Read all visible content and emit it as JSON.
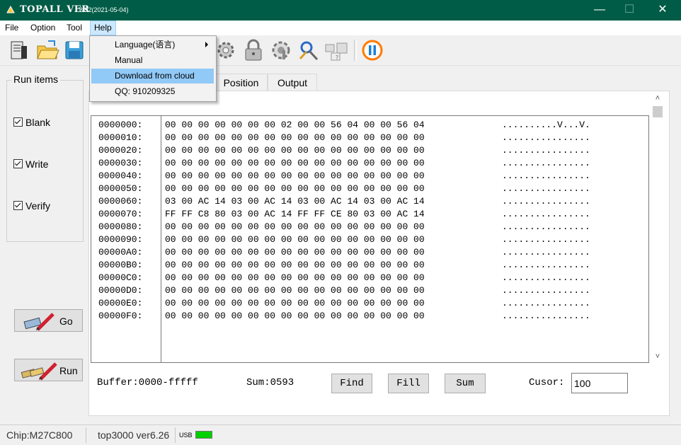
{
  "window": {
    "title": "TOPALL VER",
    "version": "8.92(2021-05-04)",
    "minimize": "—",
    "maximize": "☐",
    "close": "✕"
  },
  "menu": {
    "file": "File",
    "option": "Option",
    "tool": "Tool",
    "help": "Help"
  },
  "help_menu": {
    "language": "Language(语言)",
    "manual": "Manual",
    "download": "Download from  cloud",
    "qq": "QQ: 910209325"
  },
  "run_items": {
    "title": "Run items",
    "blank": "Blank",
    "write": "Write",
    "verify": "Verify",
    "go": "Go",
    "run": "Run"
  },
  "tabs": {
    "position": "Position",
    "output": "Output"
  },
  "hex": {
    "rows": [
      {
        "addr": "0000000:",
        "bytes": "00 00 00 00 00 00 00 02 00 00 56 04 00 00 56 04",
        "ascii": "..........V...V."
      },
      {
        "addr": "0000010:",
        "bytes": "00 00 00 00 00 00 00 00 00 00 00 00 00 00 00 00",
        "ascii": "................"
      },
      {
        "addr": "0000020:",
        "bytes": "00 00 00 00 00 00 00 00 00 00 00 00 00 00 00 00",
        "ascii": "................"
      },
      {
        "addr": "0000030:",
        "bytes": "00 00 00 00 00 00 00 00 00 00 00 00 00 00 00 00",
        "ascii": "................"
      },
      {
        "addr": "0000040:",
        "bytes": "00 00 00 00 00 00 00 00 00 00 00 00 00 00 00 00",
        "ascii": "................"
      },
      {
        "addr": "0000050:",
        "bytes": "00 00 00 00 00 00 00 00 00 00 00 00 00 00 00 00",
        "ascii": "................"
      },
      {
        "addr": "0000060:",
        "bytes": "03 00 AC 14 03 00 AC 14 03 00 AC 14 03 00 AC 14",
        "ascii": "................"
      },
      {
        "addr": "0000070:",
        "bytes": "FF FF C8 80 03 00 AC 14 FF FF CE 80 03 00 AC 14",
        "ascii": "................"
      },
      {
        "addr": "0000080:",
        "bytes": "00 00 00 00 00 00 00 00 00 00 00 00 00 00 00 00",
        "ascii": "................"
      },
      {
        "addr": "0000090:",
        "bytes": "00 00 00 00 00 00 00 00 00 00 00 00 00 00 00 00",
        "ascii": "................"
      },
      {
        "addr": "00000A0:",
        "bytes": "00 00 00 00 00 00 00 00 00 00 00 00 00 00 00 00",
        "ascii": "................"
      },
      {
        "addr": "00000B0:",
        "bytes": "00 00 00 00 00 00 00 00 00 00 00 00 00 00 00 00",
        "ascii": "................"
      },
      {
        "addr": "00000C0:",
        "bytes": "00 00 00 00 00 00 00 00 00 00 00 00 00 00 00 00",
        "ascii": "................"
      },
      {
        "addr": "00000D0:",
        "bytes": "00 00 00 00 00 00 00 00 00 00 00 00 00 00 00 00",
        "ascii": "................"
      },
      {
        "addr": "00000E0:",
        "bytes": "00 00 00 00 00 00 00 00 00 00 00 00 00 00 00 00",
        "ascii": "................"
      },
      {
        "addr": "00000F0:",
        "bytes": "00 00 00 00 00 00 00 00 00 00 00 00 00 00 00 00",
        "ascii": "................"
      }
    ]
  },
  "buffer": {
    "range": "Buffer:0000-fffff",
    "sum": "Sum:0593",
    "find": "Find",
    "fill": "Fill",
    "sum_button": "Sum",
    "cusor_label": "Cusor:",
    "cusor_value": "100"
  },
  "status": {
    "chip": "Chip:M27C800",
    "device": "top3000 ver6.26",
    "usb": "USB"
  },
  "icons": [
    "chip-icon",
    "open-folder-icon",
    "save-disk-icon",
    "gear-icon",
    "lock-icon",
    "settings-icon",
    "tools-icon",
    "id-icon",
    "pause-icon"
  ],
  "colors": {
    "titlebar": "#005c46",
    "usb_indicator": "#00d000",
    "pause": "#ff7a00",
    "menu_highlight": "#91c9f7"
  }
}
